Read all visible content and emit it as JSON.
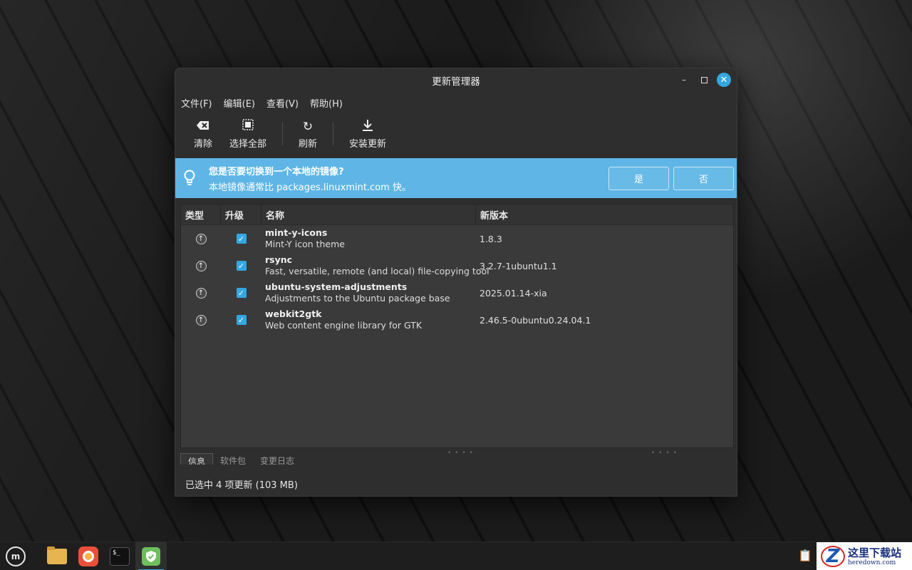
{
  "window": {
    "title": "更新管理器"
  },
  "menu": [
    "文件(F)",
    "编辑(E)",
    "查看(V)",
    "帮助(H)"
  ],
  "toolbar": {
    "clear_label": "清除",
    "select_all_label": "选择全部",
    "refresh_label": "刷新",
    "install_label": "安装更新"
  },
  "infobar": {
    "title": "您是否要切换到一个本地的镜像?",
    "subtitle": "本地镜像通常比 packages.linuxmint.com 快。",
    "yes_label": "是",
    "no_label": "否",
    "background": "#5fb6e6"
  },
  "columns": {
    "type": "类型",
    "upgrade": "升级",
    "name": "名称",
    "new_version": "新版本"
  },
  "packages": [
    {
      "name": "mint-y-icons",
      "description": "Mint-Y icon theme",
      "version": "1.8.3",
      "checked": true
    },
    {
      "name": "rsync",
      "description": "Fast, versatile, remote (and local) file-copying tool",
      "version": "3.2.7-1ubuntu1.1",
      "checked": true
    },
    {
      "name": "ubuntu-system-adjustments",
      "description": "Adjustments to the Ubuntu package base",
      "version": "2025.01.14-xia",
      "checked": true
    },
    {
      "name": "webkit2gtk",
      "description": "Web content engine library for GTK",
      "version": "2.46.5-0ubuntu0.24.04.1",
      "checked": true
    }
  ],
  "tabs": [
    "信息",
    "软件包",
    "变更日志"
  ],
  "status": "已选中 4 项更新 (103 MB)",
  "accent": "#35a7e0",
  "watermark": {
    "cn": "这里下载站",
    "en": "heredown.com"
  }
}
